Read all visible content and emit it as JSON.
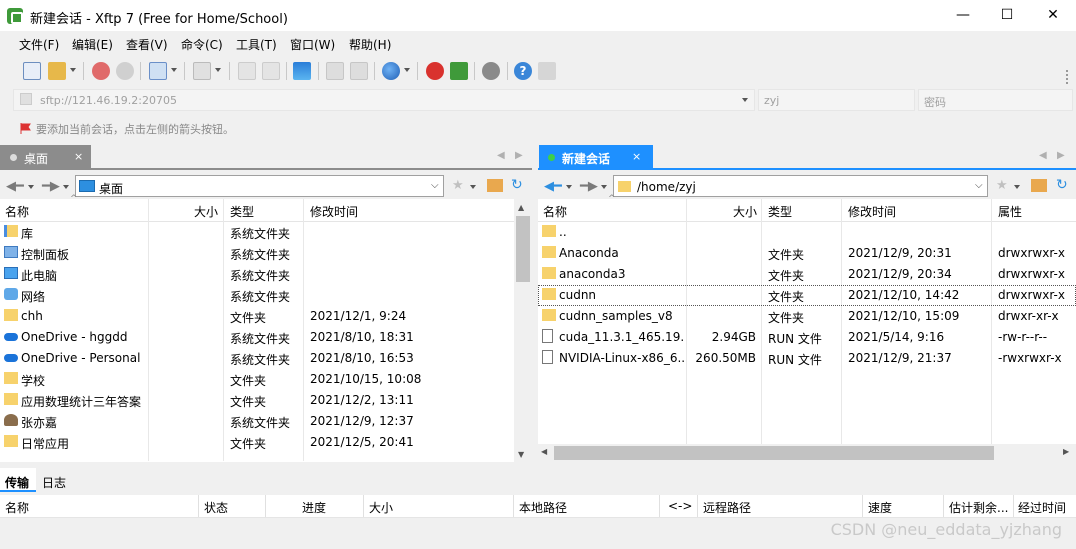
{
  "window": {
    "title": "新建会话 - Xftp 7 (Free for Home/School)",
    "minimize": "—",
    "maximize": "☐",
    "close": "✕"
  },
  "menu": [
    "文件(F)",
    "编辑(E)",
    "查看(V)",
    "命令(C)",
    "工具(T)",
    "窗口(W)",
    "帮助(H)"
  ],
  "address": {
    "host": "sftp://121.46.19.2:20705",
    "user_placeholder": "zyj",
    "password_placeholder": "密码"
  },
  "hint": "要添加当前会话，点击左侧的箭头按钮。",
  "left_panel": {
    "tab_label": "桌面",
    "tab_close": "×",
    "path": "桌面",
    "columns": [
      "名称",
      "大小",
      "类型",
      "修改时间"
    ],
    "rows": [
      {
        "name": "库",
        "size": "",
        "type": "系统文件夹",
        "modified": "",
        "icon": "library-icon"
      },
      {
        "name": "控制面板",
        "size": "",
        "type": "系统文件夹",
        "modified": "",
        "icon": "control-panel-icon"
      },
      {
        "name": "此电脑",
        "size": "",
        "type": "系统文件夹",
        "modified": "",
        "icon": "computer-icon"
      },
      {
        "name": "网络",
        "size": "",
        "type": "系统文件夹",
        "modified": "",
        "icon": "network-icon"
      },
      {
        "name": "chh",
        "size": "",
        "type": "文件夹",
        "modified": "2021/12/1, 9:24",
        "icon": "folder-icon"
      },
      {
        "name": "OneDrive - hggdd",
        "size": "",
        "type": "系统文件夹",
        "modified": "2021/8/10, 18:31",
        "icon": "onedrive-icon"
      },
      {
        "name": "OneDrive - Personal",
        "size": "",
        "type": "系统文件夹",
        "modified": "2021/8/10, 16:53",
        "icon": "onedrive-icon"
      },
      {
        "name": "学校",
        "size": "",
        "type": "文件夹",
        "modified": "2021/10/15, 10:08",
        "icon": "folder-icon"
      },
      {
        "name": "应用数理统计三年答案",
        "size": "",
        "type": "文件夹",
        "modified": "2021/12/2, 13:11",
        "icon": "folder-icon"
      },
      {
        "name": "张亦嘉",
        "size": "",
        "type": "系统文件夹",
        "modified": "2021/12/9, 12:37",
        "icon": "user-icon"
      },
      {
        "name": "日常应用",
        "size": "",
        "type": "文件夹",
        "modified": "2021/12/5, 20:41",
        "icon": "folder-icon"
      }
    ]
  },
  "right_panel": {
    "tab_label": "新建会话",
    "tab_close": "×",
    "path": "/home/zyj",
    "columns": [
      "名称",
      "大小",
      "类型",
      "修改时间",
      "属性"
    ],
    "rows": [
      {
        "name": "..",
        "size": "",
        "type": "",
        "modified": "",
        "attr": "",
        "icon": "folder-icon"
      },
      {
        "name": "Anaconda",
        "size": "",
        "type": "文件夹",
        "modified": "2021/12/9, 20:31",
        "attr": "drwxrwxr-x",
        "icon": "folder-icon"
      },
      {
        "name": "anaconda3",
        "size": "",
        "type": "文件夹",
        "modified": "2021/12/9, 20:34",
        "attr": "drwxrwxr-x",
        "icon": "folder-icon"
      },
      {
        "name": "cudnn",
        "size": "",
        "type": "文件夹",
        "modified": "2021/12/10, 14:42",
        "attr": "drwxrwxr-x",
        "icon": "folder-icon"
      },
      {
        "name": "cudnn_samples_v8",
        "size": "",
        "type": "文件夹",
        "modified": "2021/12/10, 15:09",
        "attr": "drwxr-xr-x",
        "icon": "folder-icon"
      },
      {
        "name": "cuda_11.3.1_465.19....",
        "size": "2.94GB",
        "type": "RUN 文件",
        "modified": "2021/5/14, 9:16",
        "attr": "-rw-r--r--",
        "icon": "file-icon"
      },
      {
        "name": "NVIDIA-Linux-x86_6...",
        "size": "260.50MB",
        "type": "RUN 文件",
        "modified": "2021/12/9, 21:37",
        "attr": "-rwxrwxr-x",
        "icon": "file-icon"
      }
    ]
  },
  "bottom": {
    "tabs": [
      "传输",
      "日志"
    ],
    "columns": [
      "名称",
      "状态",
      "进度",
      "大小",
      "本地路径",
      "<->",
      "远程路径",
      "速度",
      "估计剩余...",
      "经过时间"
    ]
  },
  "watermark": "CSDN @neu_eddata_yjzhang",
  "colors": {
    "accent": "#1e90ff",
    "inactive_tab": "#8c8c8c",
    "folder": "#f7d26c"
  }
}
